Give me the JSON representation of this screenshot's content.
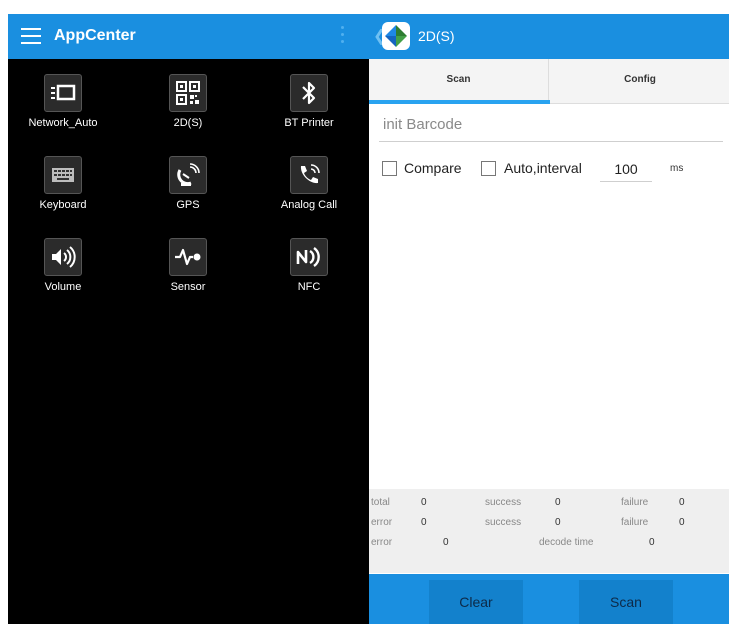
{
  "left_panel": {
    "title": "AppCenter",
    "apps": [
      {
        "label": "Network_Auto",
        "icon": "network-icon"
      },
      {
        "label": "2D(S)",
        "icon": "qr-code-icon"
      },
      {
        "label": "BT Printer",
        "icon": "bluetooth-icon"
      },
      {
        "label": "Keyboard",
        "icon": "keyboard-icon"
      },
      {
        "label": "GPS",
        "icon": "gps-dish-icon"
      },
      {
        "label": "Analog Call",
        "icon": "phone-ringing-icon"
      },
      {
        "label": "Volume",
        "icon": "speaker-icon"
      },
      {
        "label": "Sensor",
        "icon": "sensor-icon"
      },
      {
        "label": "NFC",
        "icon": "nfc-icon"
      }
    ]
  },
  "right_panel": {
    "title": "2D(S)",
    "tabs": [
      {
        "label": "Scan",
        "active": true
      },
      {
        "label": "Config",
        "active": false
      }
    ],
    "barcode_field": {
      "placeholder": "init Barcode"
    },
    "options": {
      "compare_label": "Compare",
      "auto_label": "Auto,interval",
      "interval_value": "100",
      "interval_unit": "ms"
    },
    "stats": {
      "row1": {
        "total_label": "total",
        "total_value": "0",
        "success_label": "success",
        "success_value": "0",
        "failure_label": "failure",
        "failure_value": "0"
      },
      "row2": {
        "error_label": "error",
        "error_value": "0",
        "success_label": "success",
        "success_value": "0",
        "failure_label": "failure",
        "failure_value": "0"
      },
      "row3": {
        "error_label": "error",
        "error_value": "0",
        "decode_label": "decode time",
        "decode_value": "0"
      }
    },
    "buttons": {
      "clear": "Clear",
      "scan": "Scan"
    }
  },
  "colors": {
    "accent": "#1a8fe0",
    "tab_indicator": "#29a3f0",
    "button": "#1381cc"
  }
}
